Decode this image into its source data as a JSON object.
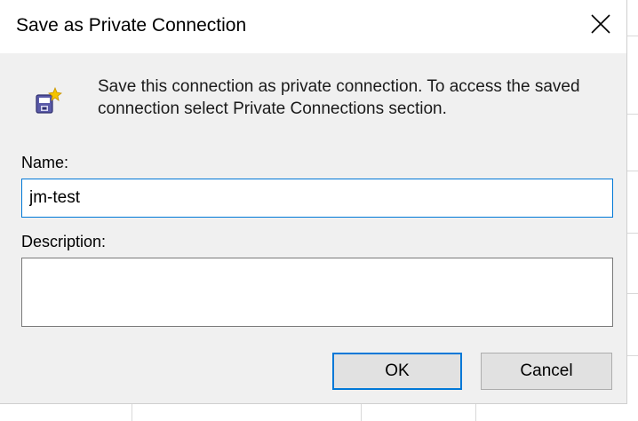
{
  "dialog": {
    "title": "Save as Private Connection",
    "close_glyph": "✕",
    "info_icon": "connection-star-icon",
    "info_text": "Save this connection as private connection. To access the saved connection select Private Connections section.",
    "name_label": "Name:",
    "name_value": "jm-test",
    "description_label": "Description:",
    "description_value": "",
    "ok_label": "OK",
    "cancel_label": "Cancel"
  },
  "colors": {
    "accent": "#0078d7",
    "dialog_bg": "#f0f0f0",
    "button_bg": "#e1e1e1"
  }
}
